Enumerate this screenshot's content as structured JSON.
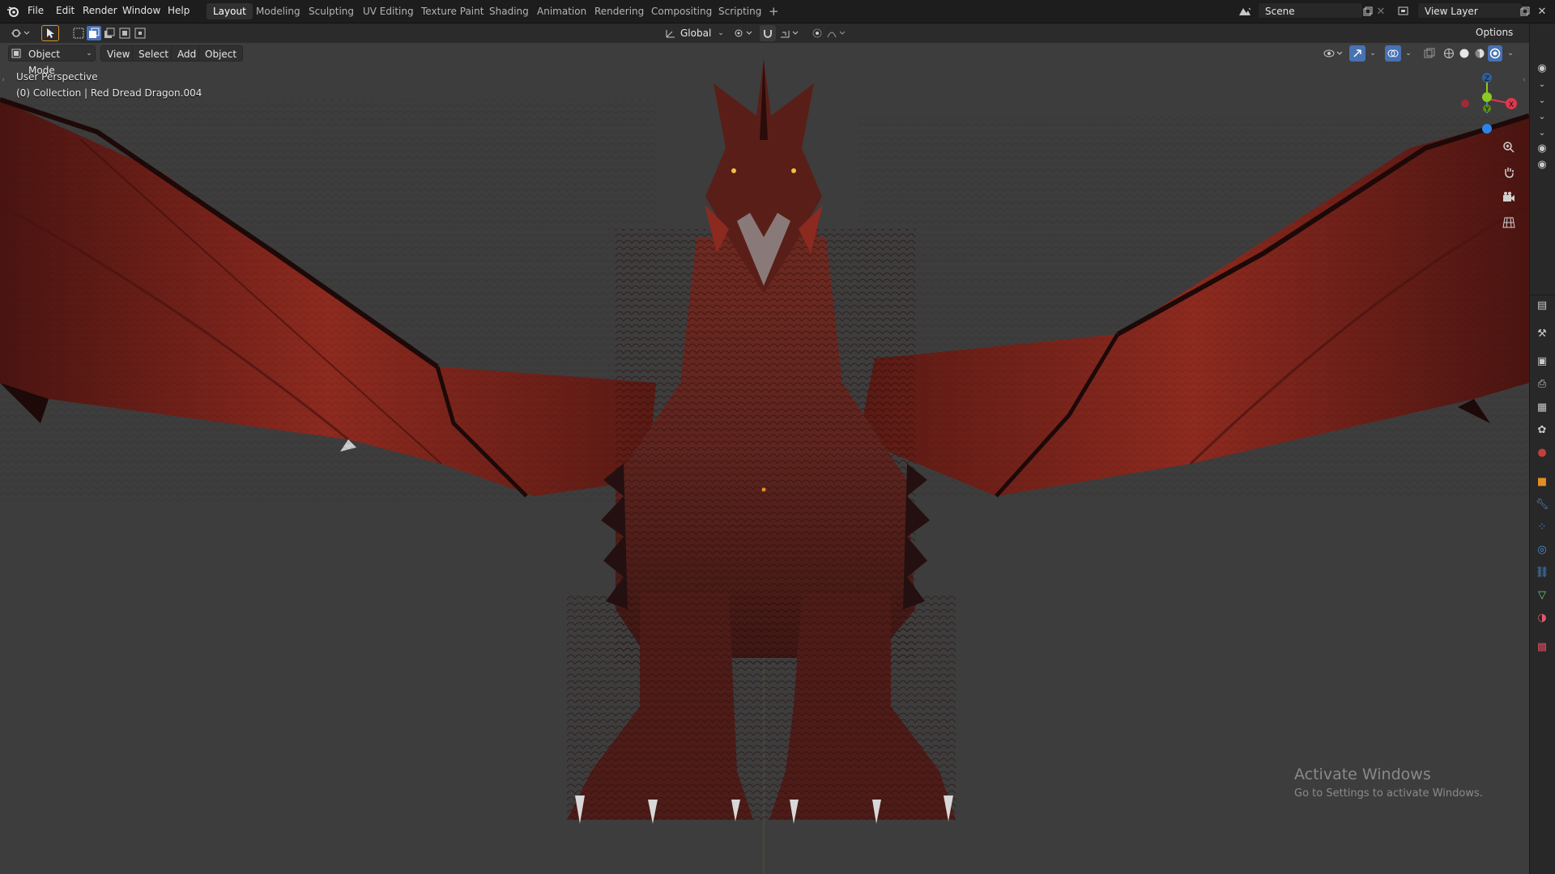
{
  "menu": {
    "items": [
      "File",
      "Edit",
      "Render",
      "Window",
      "Help"
    ]
  },
  "workspaces": {
    "tabs": [
      "Layout",
      "Modeling",
      "Sculpting",
      "UV Editing",
      "Texture Paint",
      "Shading",
      "Animation",
      "Rendering",
      "Compositing",
      "Scripting"
    ],
    "add_label": "+"
  },
  "scene": {
    "name": "Scene",
    "view_layer": "View Layer"
  },
  "toolbar": {
    "orientation": "Global",
    "options_label": "Options"
  },
  "viewport_header": {
    "mode": "Object Mode",
    "menus": [
      "View",
      "Select",
      "Add",
      "Object"
    ]
  },
  "viewport": {
    "perspective_label": "User Perspective",
    "collection_label": "(0) Collection | Red Dread Dragon.004"
  },
  "gizmo": {
    "x": "X",
    "y": "Y",
    "z": "Z"
  },
  "watermark": {
    "title": "Activate Windows",
    "subtitle": "Go to Settings to activate Windows."
  },
  "colors": {
    "accent": "#e28d25",
    "axis_x": "#e3354b",
    "axis_y": "#8bca1e",
    "axis_z": "#2f83e6",
    "dragon": "#8a2a22"
  }
}
